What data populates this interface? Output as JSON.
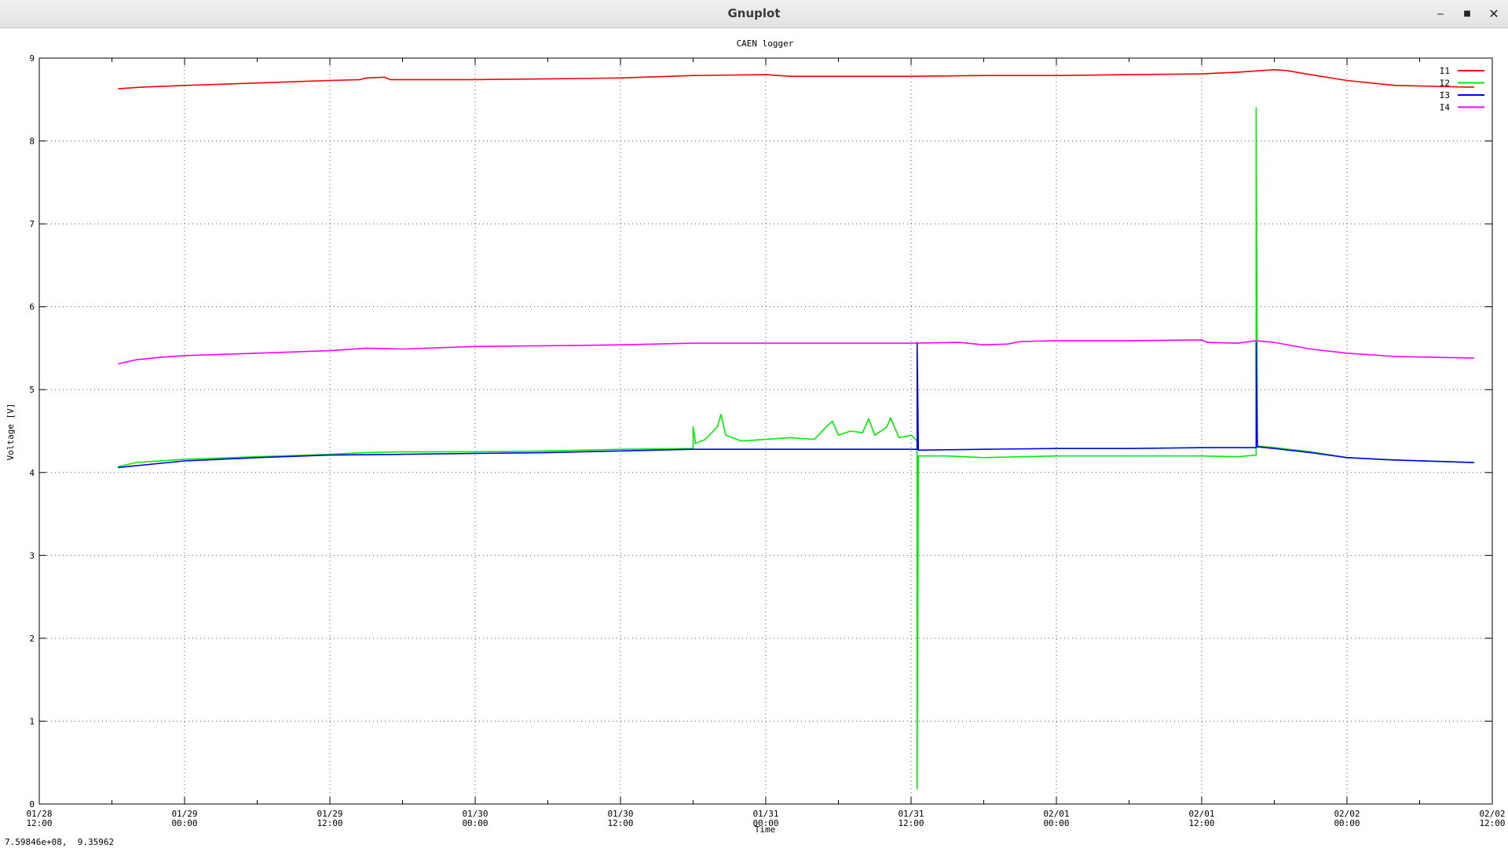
{
  "window": {
    "title": "Gnuplot",
    "minimize_icon": "minimize-icon",
    "maximize_icon": "maximize-icon",
    "close_icon": "close-icon",
    "minimize_glyph": "‒",
    "maximize_glyph": "■",
    "close_glyph": "✕"
  },
  "status_bar": {
    "coordinates": "7.59846e+08,  9.35962"
  },
  "chart_data": {
    "type": "line",
    "title": "CAEN logger",
    "xlabel": "Time",
    "ylabel": "Voltage [V]",
    "ylim": [
      0,
      9
    ],
    "yticks": [
      "0",
      "1",
      "2",
      "3",
      "4",
      "5",
      "6",
      "7",
      "8",
      "9"
    ],
    "xlim_hours": [
      0,
      120
    ],
    "xticks": [
      {
        "hour": 0,
        "date": "01/28",
        "time": "12:00"
      },
      {
        "hour": 12,
        "date": "01/29",
        "time": "00:00"
      },
      {
        "hour": 24,
        "date": "01/29",
        "time": "12:00"
      },
      {
        "hour": 36,
        "date": "01/30",
        "time": "00:00"
      },
      {
        "hour": 48,
        "date": "01/30",
        "time": "12:00"
      },
      {
        "hour": 60,
        "date": "01/31",
        "time": "00:00"
      },
      {
        "hour": 72,
        "date": "01/31",
        "time": "12:00"
      },
      {
        "hour": 84,
        "date": "02/01",
        "time": "00:00"
      },
      {
        "hour": 96,
        "date": "02/01",
        "time": "12:00"
      },
      {
        "hour": 108,
        "date": "02/02",
        "time": "00:00"
      },
      {
        "hour": 120,
        "date": "02/02",
        "time": "12:00"
      }
    ],
    "grid": true,
    "legend_position": "top-right",
    "series": [
      {
        "name": "I1",
        "color": "#ff0000",
        "points": [
          [
            6.5,
            8.63
          ],
          [
            8.5,
            8.65
          ],
          [
            12,
            8.67
          ],
          [
            18,
            8.7
          ],
          [
            24,
            8.73
          ],
          [
            26.5,
            8.74
          ],
          [
            27,
            8.76
          ],
          [
            28.5,
            8.77
          ],
          [
            29,
            8.74
          ],
          [
            36,
            8.74
          ],
          [
            42,
            8.75
          ],
          [
            48,
            8.76
          ],
          [
            54,
            8.79
          ],
          [
            60,
            8.8
          ],
          [
            62,
            8.78
          ],
          [
            66,
            8.78
          ],
          [
            72,
            8.78
          ],
          [
            78,
            8.79
          ],
          [
            84,
            8.79
          ],
          [
            90,
            8.8
          ],
          [
            96,
            8.81
          ],
          [
            99,
            8.83
          ],
          [
            101,
            8.85
          ],
          [
            102,
            8.86
          ],
          [
            103,
            8.85
          ],
          [
            105,
            8.8
          ],
          [
            108,
            8.73
          ],
          [
            110,
            8.7
          ],
          [
            112,
            8.67
          ],
          [
            118,
            8.65
          ],
          [
            118.5,
            8.65
          ]
        ]
      },
      {
        "name": "I2",
        "color": "#00ee00",
        "points": [
          [
            6.5,
            4.07
          ],
          [
            8,
            4.12
          ],
          [
            12,
            4.16
          ],
          [
            18,
            4.19
          ],
          [
            24,
            4.22
          ],
          [
            27,
            4.24
          ],
          [
            30,
            4.25
          ],
          [
            36,
            4.25
          ],
          [
            42,
            4.26
          ],
          [
            48,
            4.28
          ],
          [
            54,
            4.29
          ],
          [
            54,
            4.55
          ],
          [
            54.2,
            4.35
          ],
          [
            55,
            4.4
          ],
          [
            56,
            4.55
          ],
          [
            56.3,
            4.7
          ],
          [
            56.7,
            4.45
          ],
          [
            58,
            4.38
          ],
          [
            60,
            4.4
          ],
          [
            62,
            4.42
          ],
          [
            64,
            4.4
          ],
          [
            65,
            4.55
          ],
          [
            65.5,
            4.62
          ],
          [
            66,
            4.45
          ],
          [
            67,
            4.5
          ],
          [
            68,
            4.48
          ],
          [
            68.5,
            4.65
          ],
          [
            69,
            4.45
          ],
          [
            70,
            4.55
          ],
          [
            70.3,
            4.66
          ],
          [
            71,
            4.42
          ],
          [
            72,
            4.45
          ],
          [
            72.5,
            4.38
          ],
          [
            72.5,
            0.18
          ],
          [
            72.6,
            4.2
          ],
          [
            75,
            4.2
          ],
          [
            78,
            4.18
          ],
          [
            81,
            4.19
          ],
          [
            84,
            4.2
          ],
          [
            90,
            4.2
          ],
          [
            96,
            4.2
          ],
          [
            99,
            4.19
          ],
          [
            100.5,
            4.21
          ],
          [
            100.5,
            8.4
          ],
          [
            100.6,
            4.32
          ],
          [
            102,
            4.3
          ],
          [
            105,
            4.25
          ],
          [
            108,
            4.18
          ],
          [
            112,
            4.15
          ],
          [
            118.5,
            4.12
          ]
        ]
      },
      {
        "name": "I3",
        "color": "#0000ff",
        "points": [
          [
            6.5,
            4.06
          ],
          [
            12,
            4.14
          ],
          [
            18,
            4.18
          ],
          [
            24,
            4.21
          ],
          [
            30,
            4.22
          ],
          [
            36,
            4.23
          ],
          [
            42,
            4.24
          ],
          [
            48,
            4.26
          ],
          [
            54,
            4.28
          ],
          [
            60,
            4.28
          ],
          [
            66,
            4.28
          ],
          [
            72.5,
            4.28
          ],
          [
            72.5,
            5.57
          ],
          [
            72.6,
            4.27
          ],
          [
            78,
            4.28
          ],
          [
            84,
            4.29
          ],
          [
            90,
            4.29
          ],
          [
            96,
            4.3
          ],
          [
            100.5,
            4.3
          ],
          [
            100.5,
            5.57
          ],
          [
            100.6,
            4.31
          ],
          [
            102,
            4.29
          ],
          [
            105,
            4.24
          ],
          [
            108,
            4.18
          ],
          [
            112,
            4.15
          ],
          [
            118.5,
            4.12
          ]
        ]
      },
      {
        "name": "I4",
        "color": "#ff00ff",
        "points": [
          [
            6.5,
            5.31
          ],
          [
            8,
            5.36
          ],
          [
            10,
            5.39
          ],
          [
            12,
            5.41
          ],
          [
            18,
            5.44
          ],
          [
            24,
            5.47
          ],
          [
            27,
            5.5
          ],
          [
            30,
            5.49
          ],
          [
            36,
            5.52
          ],
          [
            42,
            5.53
          ],
          [
            48,
            5.54
          ],
          [
            54,
            5.56
          ],
          [
            60,
            5.56
          ],
          [
            66,
            5.56
          ],
          [
            72,
            5.56
          ],
          [
            76,
            5.57
          ],
          [
            78,
            5.54
          ],
          [
            80,
            5.55
          ],
          [
            81,
            5.58
          ],
          [
            84,
            5.59
          ],
          [
            90,
            5.59
          ],
          [
            96,
            5.6
          ],
          [
            96.5,
            5.57
          ],
          [
            99,
            5.56
          ],
          [
            100.5,
            5.59
          ],
          [
            102,
            5.57
          ],
          [
            105,
            5.49
          ],
          [
            108,
            5.44
          ],
          [
            112,
            5.4
          ],
          [
            118.5,
            5.38
          ]
        ]
      }
    ]
  }
}
